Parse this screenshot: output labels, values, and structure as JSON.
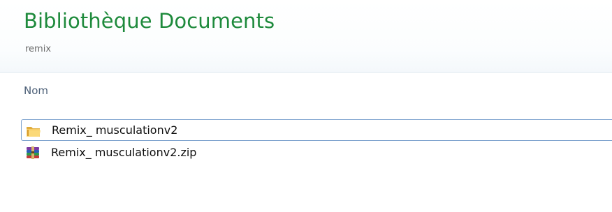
{
  "library": {
    "title": "Bibliothèque Documents",
    "subtitle": "remix"
  },
  "columns": {
    "name_label": "Nom"
  },
  "files": [
    {
      "name": "Remix_ musculationv2",
      "icon": "folder-icon",
      "focused": true
    },
    {
      "name": "Remix_ musculationv2.zip",
      "icon": "winrar-archive-icon",
      "focused": false
    }
  ],
  "colors": {
    "title": "#1e8a3c",
    "subtitle": "#6b6b6b",
    "column_header": "#4c5f77",
    "focus_border": "#7da2ce",
    "header_divider": "#dbe6ee"
  }
}
